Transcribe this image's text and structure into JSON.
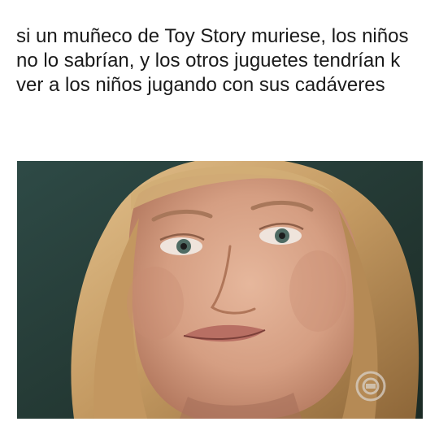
{
  "caption": "si un muñeco de Toy Story muriese, los niños no lo sabrían, y los otros juguetes tendrían k ver a los niños jugando con sus cadáveres",
  "photo": {
    "description_icon": "woman-disgusted-face-photo",
    "watermark_icon": "tv-channel-logo-icon"
  },
  "colors": {
    "background": "#ffffff",
    "text": "#1a1a1a",
    "photo_bg": "#24372f",
    "hair": "#c9a06a",
    "skin": "#d9a78c"
  }
}
